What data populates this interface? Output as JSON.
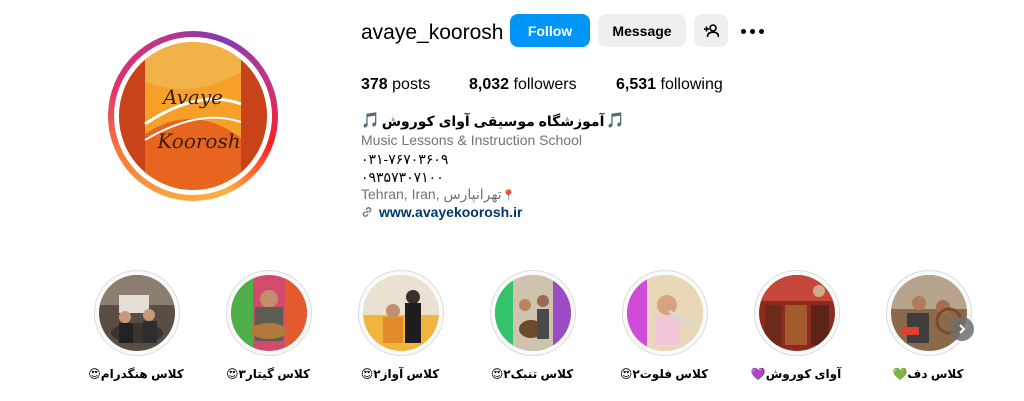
{
  "profile": {
    "username": "avaye_koorosh",
    "avatar_text_top": "Avaye",
    "avatar_text_bottom": "Koorosh",
    "follow_label": "Follow",
    "message_label": "Message",
    "add_user_icon": "person-add-icon",
    "more_icon": "more-horizontal-icon"
  },
  "stats": {
    "posts_count": "378",
    "posts_label": "posts",
    "followers_count": "8,032",
    "followers_label": "followers",
    "following_count": "6,531",
    "following_label": "following"
  },
  "bio": {
    "name": "آموزشگاه موسیقی آوای کوروش",
    "name_emoji": "🎵",
    "category": "Music Lessons & Instruction School",
    "phone1": "۰۳۱-۷۶۷۰۳۶۰۹",
    "phone2": "۰۹۳۵۷۳۰۷۱۰۰",
    "location_fa": "تهرانپارس",
    "location_en": "Tehran, Iran",
    "location_sep": ",",
    "location_pin": "📍",
    "link": "www.avayekoorosh.ir",
    "link_icon": "link-icon"
  },
  "highlights": [
    {
      "label": "کلاس هنگدرام😍",
      "ring": "#dbdbdb"
    },
    {
      "label": "کلاس گیتار۳😍",
      "ring": "#dbdbdb"
    },
    {
      "label": "کلاس آواز۲😍",
      "ring": "#dbdbdb"
    },
    {
      "label": "کلاس تنبک۲😍",
      "ring": "#dbdbdb"
    },
    {
      "label": "کلاس فلوت۲😍",
      "ring": "#dbdbdb"
    },
    {
      "label": "آوای کوروش💜",
      "ring": "#dbdbdb"
    },
    {
      "label": "کلاس دف💚",
      "ring": "#dbdbdb"
    }
  ],
  "highlights_next_icon": "chevron-right-icon",
  "colors": {
    "follow_button": "#0095f6",
    "secondary_button": "#efefef",
    "link": "#00376b",
    "muted_text": "#737373"
  }
}
